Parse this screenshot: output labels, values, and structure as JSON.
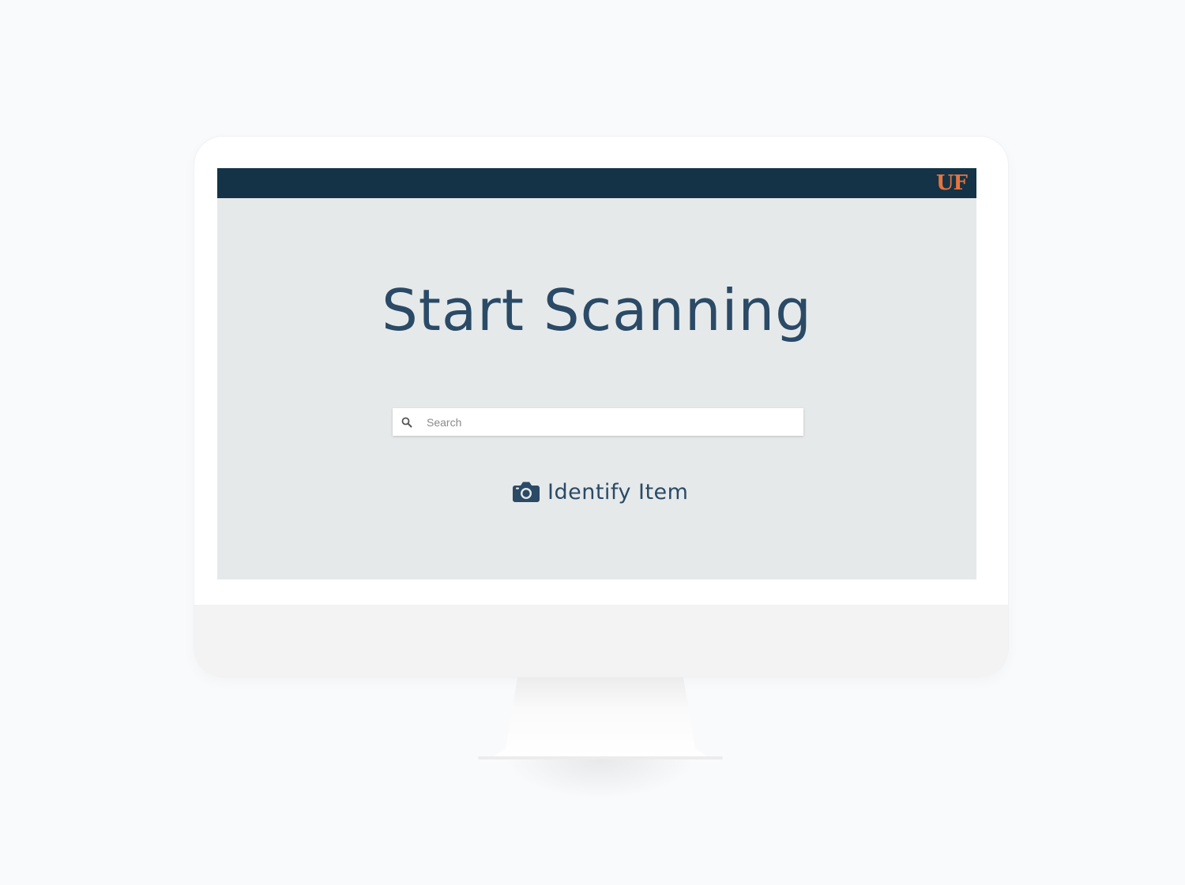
{
  "header": {
    "logo_text": "UF"
  },
  "main": {
    "title": "Start Scanning",
    "search": {
      "placeholder": "Search",
      "value": ""
    },
    "identify_label": "Identify Item"
  },
  "icons": {
    "search": "search-icon",
    "camera": "camera-icon"
  },
  "colors": {
    "header_bg": "#143346",
    "logo": "#e7743e",
    "title": "#2a4a66",
    "screen_bg": "#e6e9ea"
  }
}
